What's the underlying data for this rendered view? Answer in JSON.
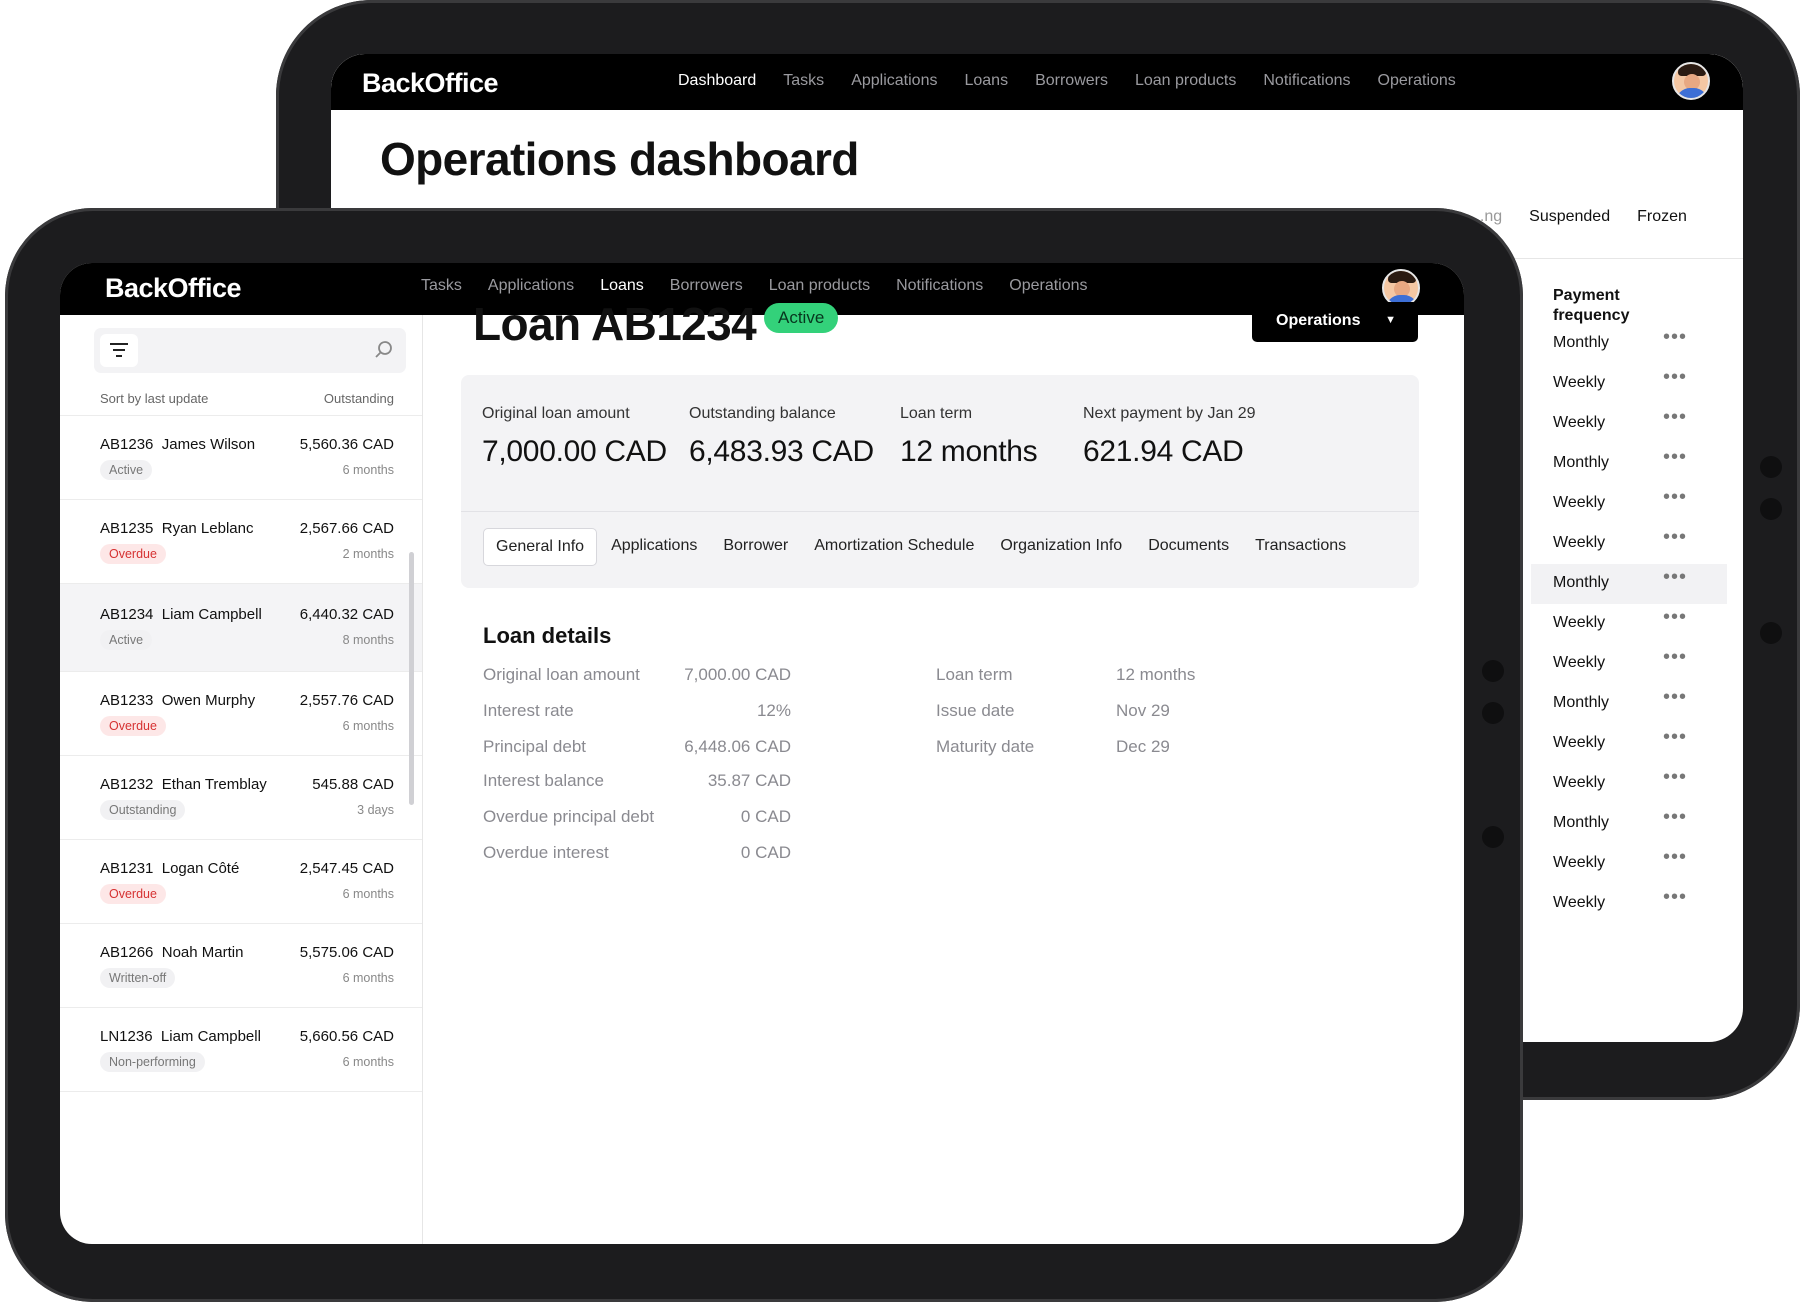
{
  "back": {
    "logo": "BackOffice",
    "nav": [
      "Dashboard",
      "Tasks",
      "Applications",
      "Loans",
      "Borrowers",
      "Loan products",
      "Notifications",
      "Operations"
    ],
    "title": "Operations dashboard",
    "filters": [
      "...ng",
      "Suspended",
      "Frozen"
    ],
    "payment_frequency_header": "Payment frequency",
    "payment_frequency": [
      "Monthly",
      "Weekly",
      "Weekly",
      "Monthly",
      "Weekly",
      "Weekly",
      "Monthly",
      "Weekly",
      "Weekly",
      "Monthly",
      "Weekly",
      "Weekly",
      "Monthly",
      "Weekly",
      "Weekly"
    ],
    "more_glyph": "•••"
  },
  "front": {
    "logo": "BackOffice",
    "nav": [
      "Tasks",
      "Applications",
      "Loans",
      "Borrowers",
      "Loan products",
      "Notifications",
      "Operations"
    ],
    "sidebar": {
      "sort_label": "Sort by last update",
      "outstanding_label": "Outstanding",
      "loans": [
        {
          "id": "AB1236",
          "name": "James Wilson",
          "amount": "5,560.36 CAD",
          "status": "Active",
          "duration": "6 months"
        },
        {
          "id": "AB1235",
          "name": "Ryan Leblanc",
          "amount": "2,567.66 CAD",
          "status": "Overdue",
          "duration": "2 months"
        },
        {
          "id": "AB1234",
          "name": "Liam Campbell",
          "amount": "6,440.32 CAD",
          "status": "Active",
          "duration": "8 months"
        },
        {
          "id": "AB1233",
          "name": "Owen Murphy",
          "amount": "2,557.76 CAD",
          "status": "Overdue",
          "duration": "6 months"
        },
        {
          "id": "AB1232",
          "name": "Ethan Tremblay",
          "amount": "545.88 CAD",
          "status": "Outstanding",
          "duration": "3 days"
        },
        {
          "id": "AB1231",
          "name": "Logan Côté",
          "amount": "2,547.45 CAD",
          "status": "Overdue",
          "duration": "6 months"
        },
        {
          "id": "AB1266",
          "name": "Noah Martin",
          "amount": "5,575.06 CAD",
          "status": "Written-off",
          "duration": "6 months"
        },
        {
          "id": "LN1236",
          "name": "Liam Campbell",
          "amount": "5,660.56 CAD",
          "status": "Non-performing",
          "duration": "6 months"
        }
      ]
    },
    "loan_title": "Loan AB1234",
    "status": "Active",
    "operations_button": "Operations",
    "summary": [
      {
        "label": "Original loan amount",
        "value": "7,000.00 CAD"
      },
      {
        "label": "Outstanding balance",
        "value": "6,483.93 CAD"
      },
      {
        "label": "Loan term",
        "value": "12 months"
      },
      {
        "label": "Next payment by Jan 29",
        "value": "621.94 CAD"
      }
    ],
    "tabs": [
      "General Info",
      "Applications",
      "Borrower",
      "Amortization Schedule",
      "Organization Info",
      "Documents",
      "Transactions"
    ],
    "details_title": "Loan details",
    "details_left": [
      {
        "label": "Original loan amount",
        "value": "7,000.00 CAD"
      },
      {
        "label": "Interest rate",
        "value": "12%"
      },
      {
        "label": "Principal debt",
        "value": "6,448.06 CAD"
      },
      {
        "label": "Interest balance",
        "value": "35.87 CAD"
      },
      {
        "label": "Overdue principal debt",
        "value": "0 CAD"
      },
      {
        "label": "Overdue interest",
        "value": "0 CAD"
      }
    ],
    "details_right": [
      {
        "label": "Loan term",
        "value": "12 months"
      },
      {
        "label": "Issue date",
        "value": "Nov 29"
      },
      {
        "label": "Maturity date",
        "value": "Dec 29"
      }
    ]
  },
  "colors": {
    "active_badge": "#33d17a",
    "overdue_badge": "#fde7e7",
    "overdue_text": "#d63232",
    "nav_bg": "#000000"
  }
}
